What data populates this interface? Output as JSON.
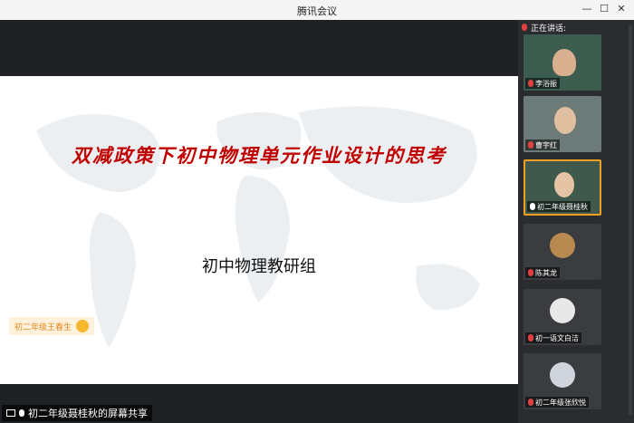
{
  "window": {
    "title": "腾讯会议",
    "min": "—",
    "max": "☐",
    "close": "✕"
  },
  "slide": {
    "title": "双减政策下初中物理单元作业设计的思考",
    "subtitle": "初中物理教研组"
  },
  "speaker_tag": {
    "label": "初二年级王春生"
  },
  "share_label": "初二年级聂桂秋的屏幕共享",
  "sidebar": {
    "speaking_label": "正在讲话:",
    "participants": [
      {
        "name": "李浴振"
      },
      {
        "name": "曹宇红"
      },
      {
        "name": "初二年级聂桂秋"
      },
      {
        "name": "陈其龙"
      },
      {
        "name": "初一语文白洁"
      },
      {
        "name": "初二年级张欣悦"
      }
    ]
  },
  "colors": {
    "title_red": "#c00000",
    "active_border": "#f0a020"
  }
}
